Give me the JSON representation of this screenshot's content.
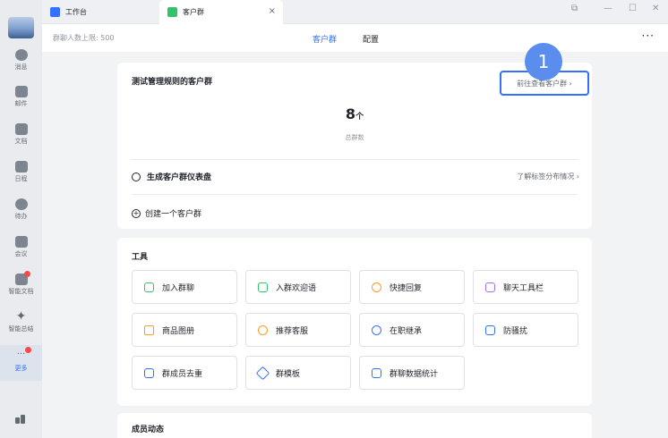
{
  "tabs": [
    {
      "label": "工作台"
    },
    {
      "label": "客户群"
    }
  ],
  "window": {
    "close": "×",
    "pin": "⧉",
    "minimize": "—",
    "maximize": "☐",
    "exit": "✕"
  },
  "sidebar": {
    "items": [
      {
        "label": "消息",
        "icon": "chat-bubble-icon"
      },
      {
        "label": "邮件",
        "icon": "mail-icon"
      },
      {
        "label": "文档",
        "icon": "document-icon"
      },
      {
        "label": "日程",
        "icon": "calendar-icon"
      },
      {
        "label": "待办",
        "icon": "check-circle-icon"
      },
      {
        "label": "会议",
        "icon": "meeting-icon"
      },
      {
        "label": "智能文档",
        "icon": "smart-doc-icon"
      },
      {
        "label": "智能总结",
        "icon": "sparkle-icon"
      },
      {
        "label": "更多",
        "icon": "more-icon"
      }
    ]
  },
  "header": {
    "limit": "群聊人数上限: 500",
    "tab_customer": "客户群",
    "tab_config": "配置",
    "more": "···"
  },
  "card1": {
    "title": "测试管理规则的客户群",
    "goto": "前往查看客户群 ›",
    "badge": "1",
    "count": "8",
    "count_unit": "个",
    "count_label": "总群数",
    "dashboard": "生成客户群仪表盘",
    "learn": "了解标签分布情况 ›",
    "create": "创建一个客户群"
  },
  "tools": {
    "title": "工具",
    "items": [
      {
        "label": "加入群聊",
        "icon": "chat-join-icon"
      },
      {
        "label": "入群欢迎语",
        "icon": "welcome-icon"
      },
      {
        "label": "快捷回复",
        "icon": "quick-reply-icon"
      },
      {
        "label": "聊天工具栏",
        "icon": "toolbar-icon"
      },
      {
        "label": "商品图册",
        "icon": "catalog-icon"
      },
      {
        "label": "推荐客服",
        "icon": "service-icon"
      },
      {
        "label": "在职继承",
        "icon": "inherit-icon"
      },
      {
        "label": "防骚扰",
        "icon": "shield-icon"
      },
      {
        "label": "群成员去重",
        "icon": "dedupe-icon"
      },
      {
        "label": "群模板",
        "icon": "template-icon"
      },
      {
        "label": "群聊数据统计",
        "icon": "stats-icon"
      }
    ]
  },
  "card3": {
    "title": "成员动态"
  },
  "colors": {
    "accent": "#3370ff",
    "badge": "#5b8def",
    "green": "#34c26a",
    "red": "#f54a45"
  }
}
